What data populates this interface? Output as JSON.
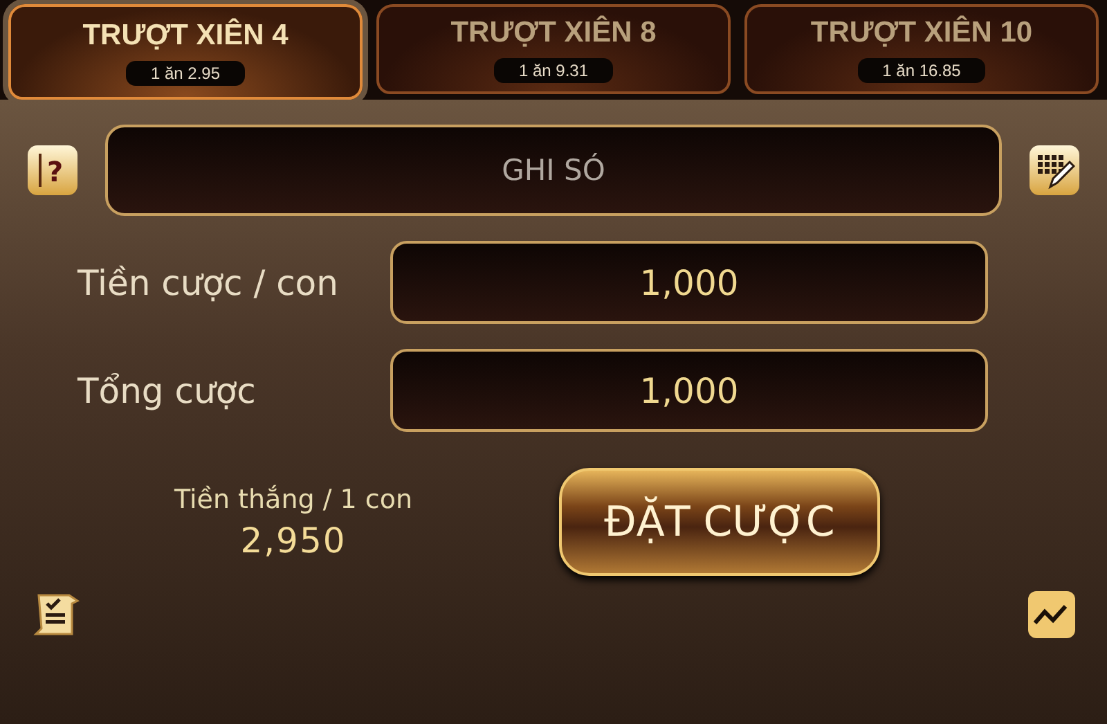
{
  "tabs": [
    {
      "label": "TRƯỢT XIÊN 4",
      "odds": "1 ăn 2.95",
      "selected": true
    },
    {
      "label": "TRƯỢT XIÊN 8",
      "odds": "1 ăn 9.31",
      "selected": false
    },
    {
      "label": "TRƯỢT XIÊN 10",
      "odds": "1 ăn 16.85",
      "selected": false
    }
  ],
  "help_icon": "?",
  "number_field": {
    "placeholder": "GHI SÓ"
  },
  "fields": [
    {
      "label": "Tiền cược / con",
      "value": "1,000"
    },
    {
      "label": "Tổng cược",
      "value": "1,000"
    }
  ],
  "winnings": {
    "label": "Tiền thắng / 1 con",
    "value": "2,950"
  },
  "bet_button": "ĐẶT CƯỢC"
}
